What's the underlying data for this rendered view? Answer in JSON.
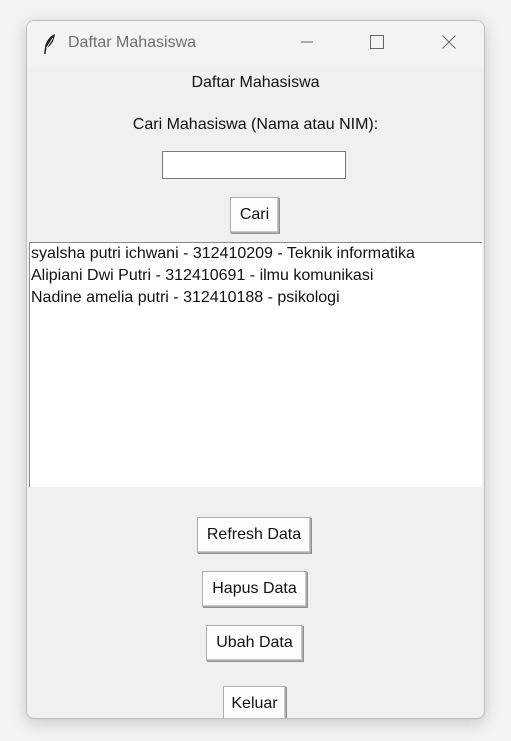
{
  "window": {
    "title": "Daftar Mahasiswa"
  },
  "heading": "Daftar Mahasiswa",
  "search": {
    "label": "Cari Mahasiswa (Nama atau NIM):",
    "value": "",
    "placeholder": "",
    "button_label": "Cari"
  },
  "students": [
    {
      "text": "syalsha putri ichwani - 312410209 - Teknik informatika"
    },
    {
      "text": "Alipiani Dwi Putri - 312410691 - ilmu komunikasi"
    },
    {
      "text": "Nadine amelia putri - 312410188 - psikologi"
    }
  ],
  "buttons": {
    "refresh": "Refresh Data",
    "delete": "Hapus Data",
    "edit": "Ubah Data",
    "exit": "Keluar"
  },
  "icons": {
    "app": "feather-icon",
    "minimize": "minimize-icon",
    "maximize": "maximize-icon",
    "close": "close-icon"
  }
}
